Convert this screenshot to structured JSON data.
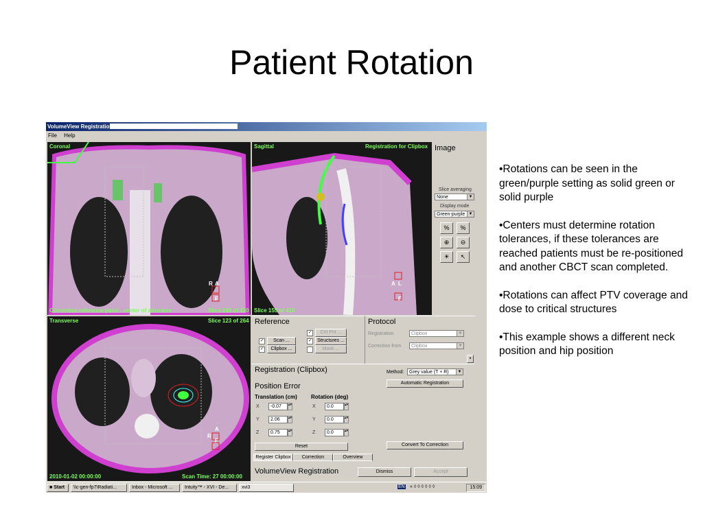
{
  "slide": {
    "title": "Patient Rotation",
    "bullets": [
      "•Rotations can be seen in the green/purple setting as solid green or solid purple",
      "•Centers must determine rotation tolerances, if these tolerances are reached patients must be re-positioned and another CBCT scan completed.",
      "•Rotations can affect PTV coverage and dose to critical structures",
      "•This example shows a different neck position and hip position"
    ]
  },
  "window": {
    "title": "VolumeView Registration:",
    "menu": [
      "File",
      "Help"
    ]
  },
  "views": {
    "coronal": {
      "label": "Coronal",
      "footer": "Correction reference point - center of structure",
      "slice": "Slice 246 of 410"
    },
    "sagittal": {
      "label": "Sagittal",
      "reg": "Registration for Clipbox",
      "slice": "Slice 155 of 410"
    },
    "transverse": {
      "label": "Transverse",
      "slice": "Slice 123 of 264",
      "date": "2010-01-02 00:00:00",
      "scan_time": "Scan Time: 27 00:00:00"
    },
    "orient": {
      "r": "R",
      "a": "A",
      "f": "F",
      "l": "L"
    }
  },
  "image_panel": {
    "heading": "Image",
    "slice_avg_label": "Slice averaging",
    "slice_avg_value": "None",
    "display_mode_label": "Display mode",
    "display_mode_value": "Green-purple"
  },
  "reference": {
    "heading": "Reference",
    "scan": "Scan ...",
    "clipbox": "Clipbox ...",
    "ctrl_pnt": "Ctrl Pnt ...",
    "structures": "Structures ...",
    "mask": "Mask ..."
  },
  "protocol": {
    "heading": "Protocol",
    "registration_label": "Registration",
    "registration_value": "Clipbox",
    "correction_label": "Correction from",
    "correction_value": "Clipbox"
  },
  "registration": {
    "heading": "Registration (Clipbox)",
    "method_label": "Method:",
    "method_value": "Grey value (T + R)",
    "auto_button": "Automatic Registration",
    "position_error": "Position Error",
    "translation_header": "Translation (cm)",
    "rotation_header": "Rotation (deg)",
    "axes": [
      "X",
      "Y",
      "Z"
    ],
    "translation": [
      "-0.07",
      "2.06",
      "0.75"
    ],
    "rotation": [
      "0.0",
      "0.0",
      "0.0"
    ],
    "reset": "Reset",
    "convert": "Convert To Correction",
    "tabs": [
      "Register Clipbox",
      "Correction",
      "Overview"
    ],
    "footer_title": "VolumeView Registration",
    "dismiss": "Dismiss",
    "accept": "Accept"
  },
  "taskbar": {
    "start": "Start",
    "items": [
      "\\\\c-gen-fp7\\Radiati...",
      "Inbox - Microsoft ...",
      "Intuity™ - XVI - De...",
      "xvi3"
    ],
    "lang": "EN",
    "time": "15:09"
  }
}
